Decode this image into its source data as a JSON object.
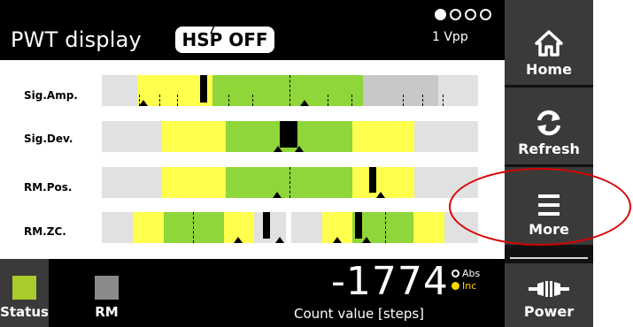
{
  "header": {
    "title": "PWT display",
    "hsp_badge": "HSP OFF",
    "signal_type": "1 Vpp",
    "signal_dots": [
      "filled",
      "empty",
      "empty",
      "empty"
    ]
  },
  "sidebar": {
    "items": [
      {
        "label": "Home",
        "icon": "home-icon"
      },
      {
        "label": "Refresh",
        "icon": "refresh-icon"
      },
      {
        "label": "More",
        "icon": "menu-icon"
      },
      {
        "label": "Power",
        "icon": "power-plug-icon"
      }
    ]
  },
  "rows": [
    {
      "label": "Sig.Amp."
    },
    {
      "label": "Sig.Dev."
    },
    {
      "label": "RM.Pos."
    },
    {
      "label": "RM.ZC."
    }
  ],
  "footer": {
    "tabs": [
      {
        "label": "Status",
        "swatch_color": "#a8cc2c",
        "active": true
      },
      {
        "label": "RM",
        "swatch_color": "#8a8a8a",
        "active": false
      }
    ],
    "count_value": "-1774",
    "count_label": "Count value [steps]",
    "mode_options": [
      {
        "label": "Abs",
        "selected": false
      },
      {
        "label": "Inc",
        "selected": true
      }
    ]
  },
  "colors": {
    "yellow": "#ffff4d",
    "green": "#8ed63a",
    "gray": "#c8c8c8",
    "highlight": "#d80000"
  }
}
